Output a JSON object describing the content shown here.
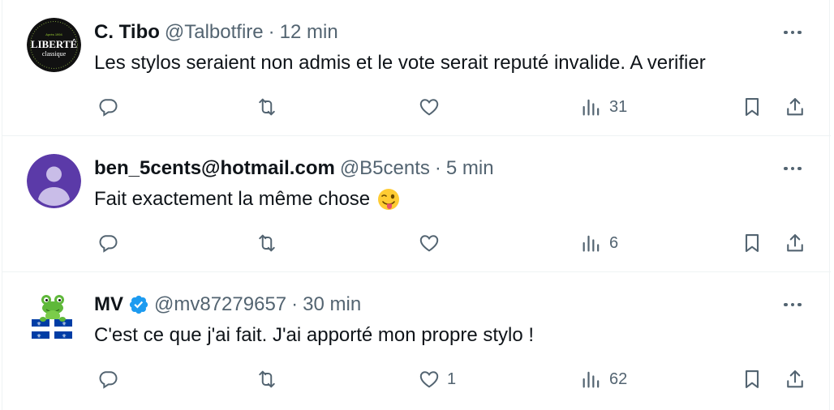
{
  "tweets": [
    {
      "name": "C. Tibo",
      "handle": "@Talbotfire",
      "sep": "·",
      "time": "12 min",
      "verified": false,
      "text": "Les stylos seraient non admis et le vote serait reputé invalide. A verifier",
      "avatar": {
        "kind": "logo",
        "logo_line1": "LIBERTÉ",
        "logo_line2": "classique",
        "logo_small": "Après 1994"
      },
      "likes": "",
      "views": "31"
    },
    {
      "name": "ben_5cents@hotmail.com",
      "handle": "@B5cents",
      "sep": "·",
      "time": "5 min",
      "verified": false,
      "text": "Fait exactement la même chose",
      "emoji": "winking-face-with-tongue",
      "avatar": {
        "kind": "default-person"
      },
      "likes": "",
      "views": "6"
    },
    {
      "name": "MV",
      "handle": "@mv87279657",
      "sep": "·",
      "time": "30 min",
      "verified": true,
      "text": "C'est ce que j'ai fait. J'ai apporté mon propre stylo !",
      "avatar": {
        "kind": "frog-quebec-flag"
      },
      "likes": "1",
      "views": "62"
    }
  ],
  "colors": {
    "text": "#0f1419",
    "secondary": "#536471",
    "verified": "#1d9bf0",
    "default_avatar_bg": "#5b3aa8",
    "quebec_blue": "#003da5"
  }
}
